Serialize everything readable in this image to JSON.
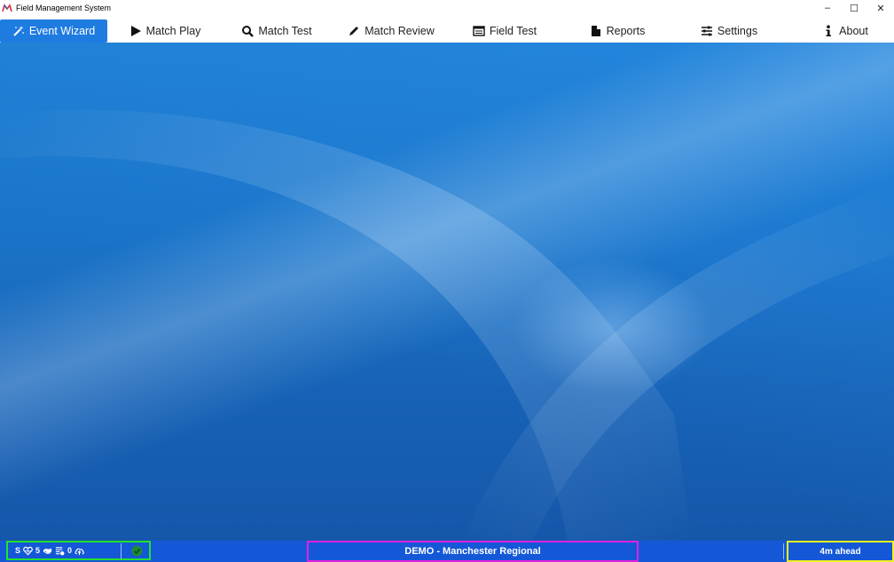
{
  "window": {
    "title": "Field Management System",
    "controls": {
      "minimize": "–",
      "maximize": "☐",
      "close": "✕"
    }
  },
  "nav": {
    "items": [
      {
        "label": "Event Wizard",
        "icon": "magic-wand-icon",
        "active": true
      },
      {
        "label": "Match Play",
        "icon": "play-icon",
        "active": false
      },
      {
        "label": "Match Test",
        "icon": "search-icon",
        "active": false
      },
      {
        "label": "Match Review",
        "icon": "pencil-icon",
        "active": false
      },
      {
        "label": "Field Test",
        "icon": "keyboard-icon",
        "active": false
      },
      {
        "label": "Reports",
        "icon": "document-icon",
        "active": false
      },
      {
        "label": "Settings",
        "icon": "sliders-icon",
        "active": false
      },
      {
        "label": "About",
        "icon": "info-icon",
        "active": false
      }
    ]
  },
  "status": {
    "left": {
      "s_label": "S",
      "health_count": "5",
      "queue_count": "0"
    },
    "event_name": "DEMO - Manchester Regional",
    "schedule_status": "4m ahead",
    "colors": {
      "bar": "#1458d8",
      "left_border": "#24e02c",
      "center_border": "#e020e0",
      "right_border": "#f0f020",
      "active_nav": "#1e7be0"
    }
  }
}
